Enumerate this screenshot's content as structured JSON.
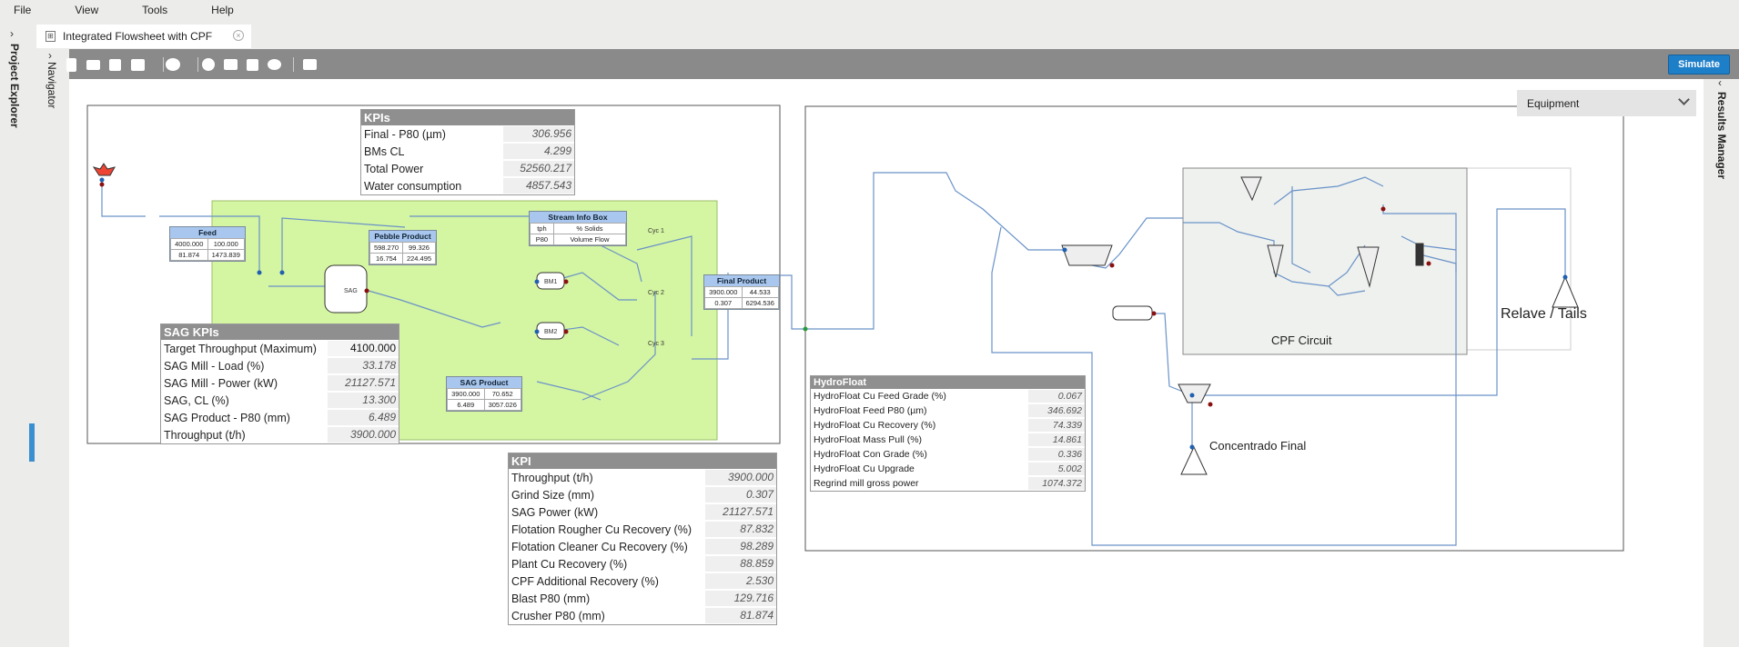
{
  "menu": [
    "File",
    "View",
    "Tools",
    "Help"
  ],
  "tab_title": "Integrated Flowsheet with CPF",
  "panels": {
    "left": "Project Explorer",
    "navigator": "Navigator",
    "right": "Results Manager"
  },
  "toolbar": {
    "simulate": "Simulate"
  },
  "equipment_dropdown": "Equipment",
  "kpis": {
    "title": "KPIs",
    "rows": [
      {
        "label": "Final - P80 (µm)",
        "value": "306.956"
      },
      {
        "label": "BMs CL",
        "value": "4.299"
      },
      {
        "label": "Total Power",
        "value": "52560.217"
      },
      {
        "label": "Water consumption",
        "value": "4857.543"
      }
    ]
  },
  "sag_kpis": {
    "title": "SAG KPIs",
    "rows": [
      {
        "label": "Target Throughput (Maximum)",
        "value": "4100.000"
      },
      {
        "label": "SAG Mill - Load (%)",
        "value": "33.178"
      },
      {
        "label": "SAG Mill - Power (kW)",
        "value": "21127.571"
      },
      {
        "label": "SAG, CL (%)",
        "value": "13.300"
      },
      {
        "label": "SAG Product - P80 (mm)",
        "value": "6.489"
      },
      {
        "label": "Throughput (t/h)",
        "value": "3900.000"
      }
    ]
  },
  "kpi": {
    "title": "KPI",
    "rows": [
      {
        "label": "Throughput (t/h)",
        "value": "3900.000"
      },
      {
        "label": "Grind Size (mm)",
        "value": "0.307"
      },
      {
        "label": "SAG Power (kW)",
        "value": "21127.571"
      },
      {
        "label": "Flotation Rougher Cu Recovery (%)",
        "value": "87.832"
      },
      {
        "label": "Flotation Cleaner Cu Recovery (%)",
        "value": "98.289"
      },
      {
        "label": "Plant Cu Recovery (%)",
        "value": "88.859"
      },
      {
        "label": "CPF Additional Recovery (%)",
        "value": "2.530"
      },
      {
        "label": "Blast P80 (mm)",
        "value": "129.716"
      },
      {
        "label": "Crusher P80 (mm)",
        "value": "81.874"
      }
    ]
  },
  "hydrofloat": {
    "title": "HydroFloat",
    "rows": [
      {
        "label": "HydroFloat Cu Feed Grade (%)",
        "value": "0.067"
      },
      {
        "label": "HydroFloat Feed P80 (µm)",
        "value": "346.692"
      },
      {
        "label": "HydroFloat Cu Recovery (%)",
        "value": "74.339"
      },
      {
        "label": "HydroFloat Mass Pull (%)",
        "value": "14.861"
      },
      {
        "label": "HydroFloat Con Grade (%)",
        "value": "0.336"
      },
      {
        "label": "HydroFloat Cu Upgrade",
        "value": "5.002"
      },
      {
        "label": "Regrind mill gross power",
        "value": "1074.372"
      }
    ]
  },
  "streams": {
    "feed": {
      "title": "Feed",
      "r1": [
        "4000.000",
        "100.000"
      ],
      "r2": [
        "81.874",
        "1473.839"
      ]
    },
    "pebble": {
      "title": "Pebble Product",
      "r1": [
        "598.270",
        "99.326"
      ],
      "r2": [
        "16.754",
        "224.495"
      ]
    },
    "sag_product": {
      "title": "SAG Product",
      "r1": [
        "3900.000",
        "70.652"
      ],
      "r2": [
        "6.489",
        "3057.026"
      ]
    },
    "final_product": {
      "title": "Final Product",
      "r1": [
        "3900.000",
        "44.533"
      ],
      "r2": [
        "0.307",
        "6294.536"
      ]
    },
    "info": {
      "title": "Stream Info Box",
      "r1": [
        "tph",
        "% Solids"
      ],
      "r2": [
        "P80",
        "Volume Flow"
      ]
    }
  },
  "labels": {
    "cpf": "CPF Circuit",
    "relave": "Relave / Tails",
    "concentrado": "Concentrado Final",
    "sag": "SAG",
    "bm1": "BM1",
    "bm2": "BM2",
    "cyc1": "Cyc 1",
    "cyc2": "Cyc 2",
    "cyc3": "Cyc 3"
  }
}
